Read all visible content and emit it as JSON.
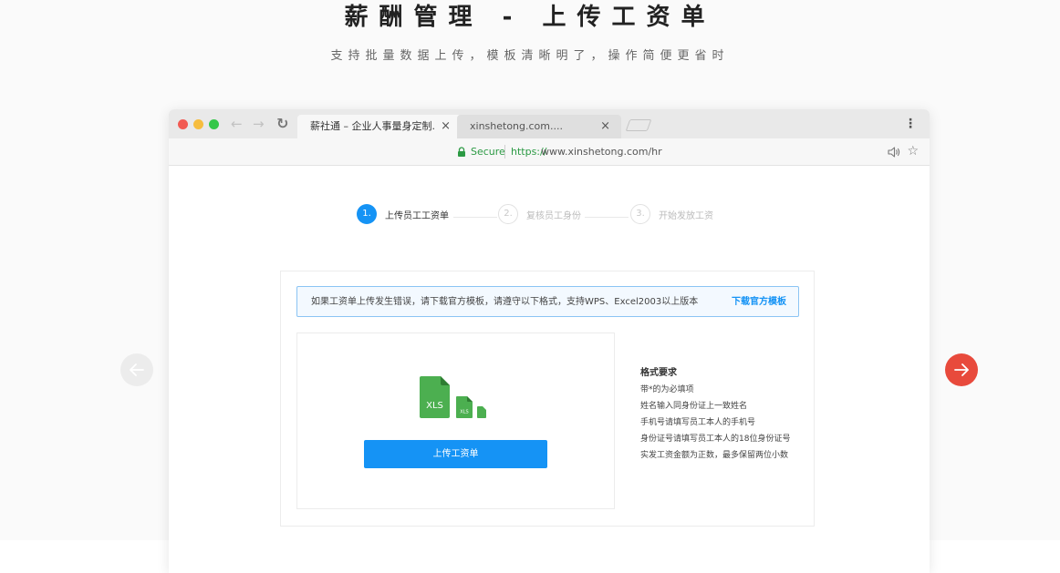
{
  "hero": {
    "title": "薪酬管理 - 上传工资单",
    "subtitle": "支持批量数据上传，模板清晰明了，操作简便更省时"
  },
  "carousel": {
    "prev_icon": "arrow-left-icon",
    "next_icon": "arrow-right-icon",
    "next_color": "#e84a3c"
  },
  "browser": {
    "tabs": [
      {
        "label": "薪社通 – 企业人事量身定制...",
        "close": "×",
        "active": true
      },
      {
        "label": "xinshetong.com....",
        "close": "×",
        "active": false
      }
    ],
    "address": {
      "secure_label": "Secure",
      "url_scheme": "https://",
      "url_rest": "www.xinshetong.com/hr"
    }
  },
  "steps": [
    {
      "number": "1.",
      "label": "上传员工工资单",
      "active": true
    },
    {
      "number": "2.",
      "label": "复核员工身份",
      "active": false
    },
    {
      "number": "3.",
      "label": "开始发放工资",
      "active": false
    }
  ],
  "alert": {
    "message": "如果工资单上传发生错误，请下载官方模板，请遵守以下格式，支持WPS、Excel2003以上版本",
    "link": "下载官方模板"
  },
  "upload": {
    "icon_label": "XLS",
    "icon_label_small": "XLS",
    "button": "上传工资单"
  },
  "format_rules": {
    "title": "格式要求",
    "items": [
      "带*的为必填项",
      "姓名输入同身份证上一致姓名",
      "手机号请填写员工本人的手机号",
      "身份证号请填写员工本人的18位身份证号",
      "实发工资金额为正数，最多保留两位小数"
    ]
  },
  "colors": {
    "accent": "#1593f5",
    "xls_green": "#4caf50",
    "secure_green": "#2c9a44"
  }
}
